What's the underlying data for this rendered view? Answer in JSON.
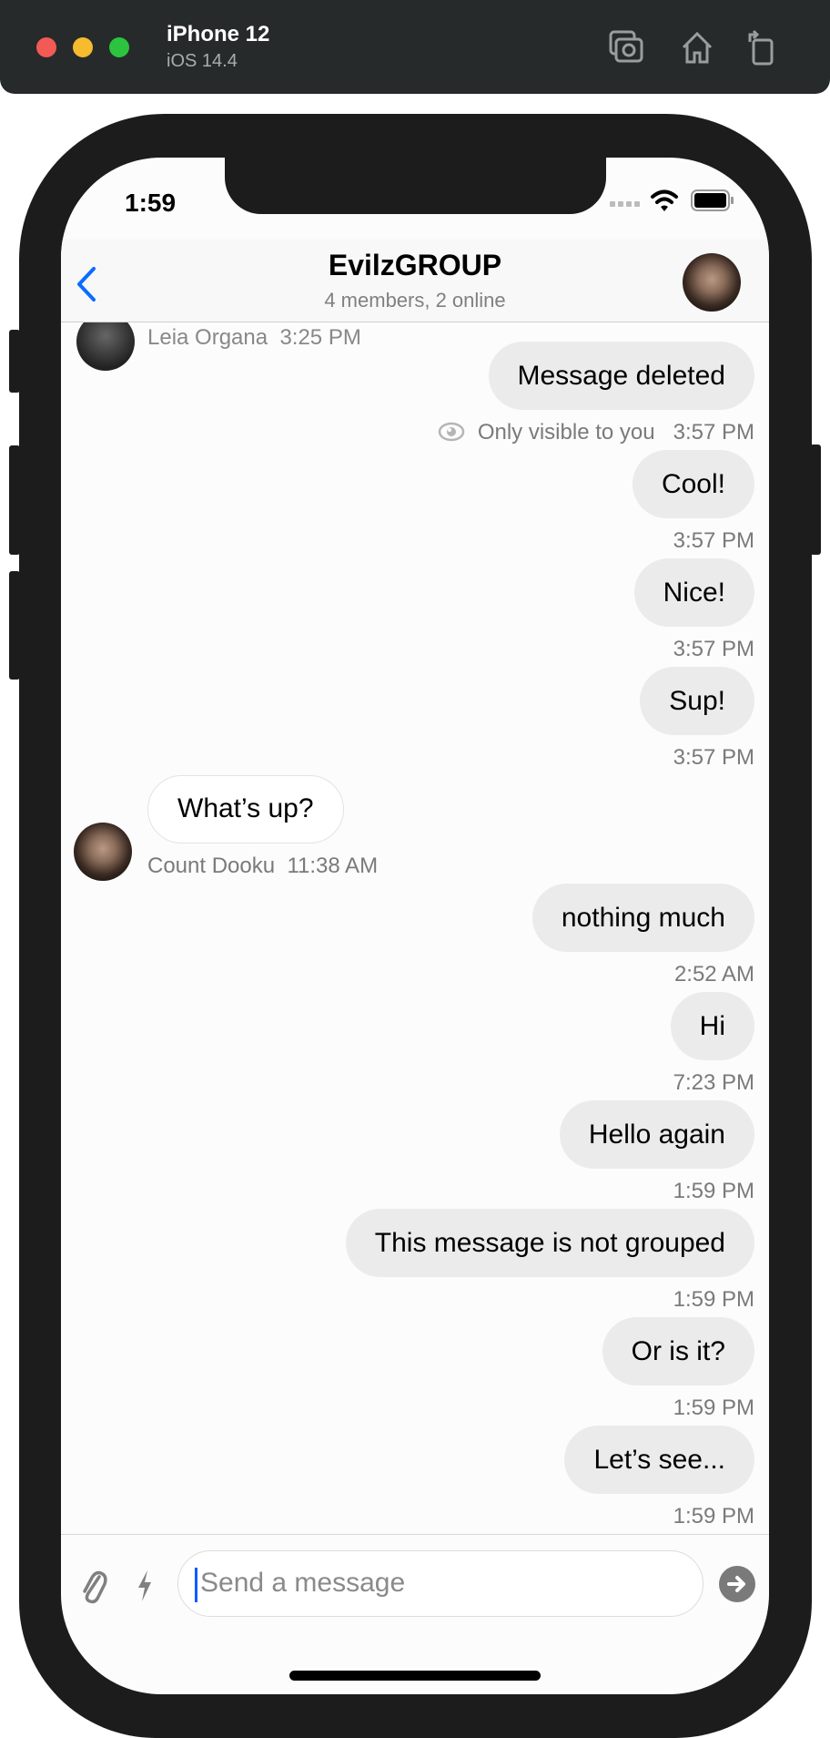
{
  "simulator": {
    "device": "iPhone 12",
    "os": "iOS 14.4",
    "icons": [
      "screenshot-icon",
      "home-icon",
      "rotate-icon"
    ]
  },
  "status_bar": {
    "time": "1:59"
  },
  "header": {
    "title": "EvilzGROUP",
    "subtitle": "4 members, 2 online",
    "back_icon": "chevron-left-icon"
  },
  "partial_message": {
    "sender": "Leia Organa",
    "time": "3:25 PM"
  },
  "messages": [
    {
      "side": "right",
      "text": "Message deleted",
      "time": "3:57 PM",
      "note": "Only visible to you"
    },
    {
      "side": "right",
      "text": "Cool!",
      "time": "3:57 PM"
    },
    {
      "side": "right",
      "text": "Nice!",
      "time": "3:57 PM"
    },
    {
      "side": "right",
      "text": "Sup!",
      "time": "3:57 PM"
    },
    {
      "side": "left",
      "text": "What’s up?",
      "sender": "Count Dooku",
      "time": "11:38 AM"
    },
    {
      "side": "right",
      "text": "nothing much",
      "time": "2:52 AM"
    },
    {
      "side": "right",
      "text": "Hi",
      "time": "7:23 PM"
    },
    {
      "side": "right",
      "text": "Hello again",
      "time": "1:59 PM"
    },
    {
      "side": "right",
      "text": "This message is not grouped",
      "time": "1:59 PM"
    },
    {
      "side": "right",
      "text": "Or is it?",
      "time": "1:59 PM"
    },
    {
      "side": "right",
      "text": "Let’s see...",
      "time": "1:59 PM"
    }
  ],
  "composer": {
    "placeholder": "Send a message"
  },
  "colors": {
    "accent": "#0a5cff",
    "bubble": "#ebebeb",
    "frame": "#1c1c1c"
  }
}
